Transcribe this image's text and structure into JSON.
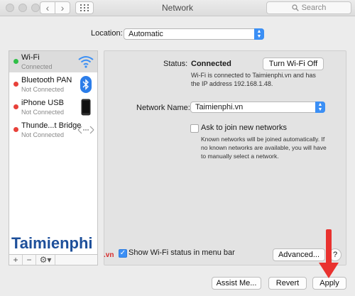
{
  "window": {
    "title": "Network"
  },
  "titlebar": {
    "search_placeholder": "Search"
  },
  "location": {
    "label": "Location:",
    "value": "Automatic"
  },
  "services": [
    {
      "name": "Wi-Fi",
      "status": "Connected",
      "status_color": "#2fbf47",
      "icon": "wifi-icon",
      "selected": true
    },
    {
      "name": "Bluetooth PAN",
      "status": "Not Connected",
      "status_color": "#e8413a",
      "icon": "bluetooth-icon"
    },
    {
      "name": "iPhone USB",
      "status": "Not Connected",
      "status_color": "#e8413a",
      "icon": "iphone-icon"
    },
    {
      "name": "Thunde...t Bridge",
      "status": "Not Connected",
      "status_color": "#e8413a",
      "icon": "thunderbolt-bridge-icon"
    }
  ],
  "sidebar_controls": {
    "add": "+",
    "remove": "−",
    "gear": "⚙▾"
  },
  "wifi_panel": {
    "status_label": "Status:",
    "status_value": "Connected",
    "toggle_button": "Turn Wi-Fi Off",
    "status_detail": "Wi-Fi is connected to Taimienphi.vn and has the IP address 192.168.1.48.",
    "network_name_label": "Network Name:",
    "network_name_value": "Taimienphi.vn",
    "ask_join_label": "Ask to join new networks",
    "ask_join_checked": false,
    "ask_join_help": "Known networks will be joined automatically. If no known networks are available, you will have to manually select a network.",
    "show_status_label": "Show Wi-Fi status in menu bar",
    "show_status_checked": true,
    "advanced_button": "Advanced...",
    "help_button": "?"
  },
  "footer": {
    "assist_button": "Assist Me...",
    "revert_button": "Revert",
    "apply_button": "Apply"
  },
  "watermark": {
    "brand": "Taimienphi",
    "suffix": ".vn"
  },
  "colors": {
    "accent": "#3b8ff5",
    "connected": "#2fbf47",
    "disconnected": "#e8413a",
    "annotation_arrow": "#e9322f"
  }
}
